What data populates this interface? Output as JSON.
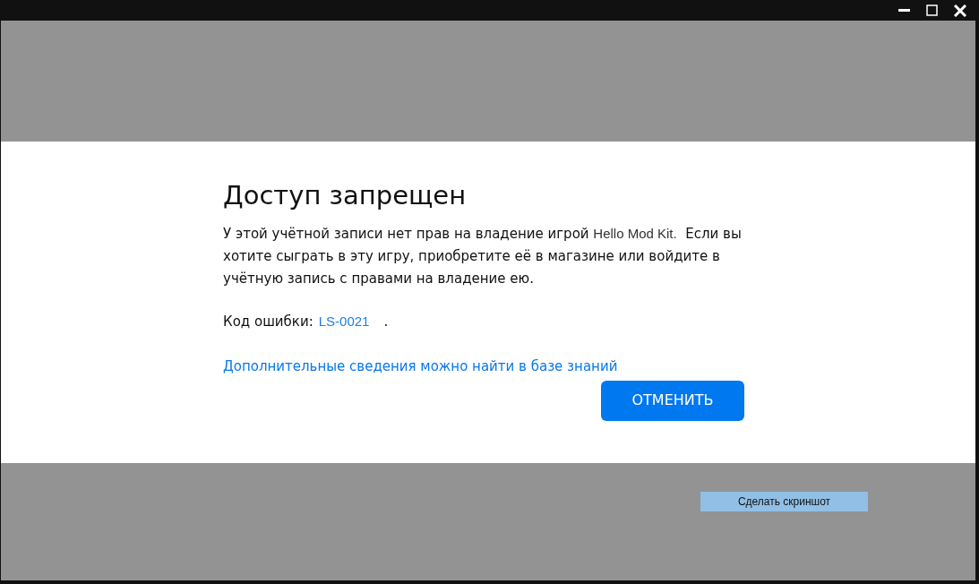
{
  "dialog": {
    "title": "Доступ запрещен",
    "message": {
      "before": "У этой учётной записи нет прав на владение игрой ",
      "game": "Hello Mod Kit.",
      "after": "  Если вы хотите сыграть в эту игру, приобретите её в магазине или войдите в учётную запись с правами на владение ею."
    },
    "error": {
      "label": "Код ошибки:",
      "code": "LS-0021",
      "end": "."
    },
    "help_link": "Дополнительные сведения можно найти в базе знаний",
    "button": "ОТМЕНИТЬ"
  },
  "screenshot_button": "Сделать скриншот"
}
